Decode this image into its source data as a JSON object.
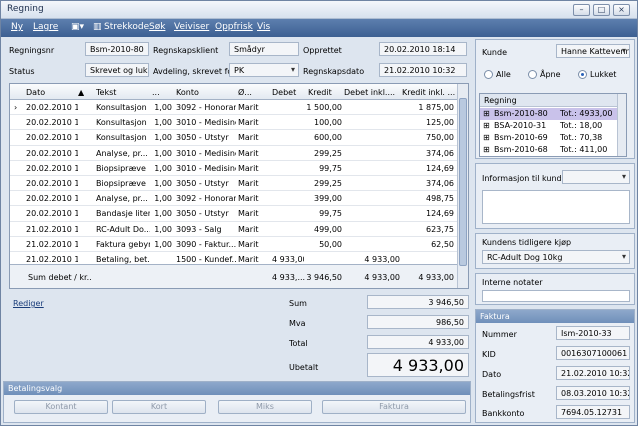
{
  "window": {
    "title": "Regning"
  },
  "menu": {
    "ny": "Ny",
    "lagre": "Lagre",
    "strekkode": "Strekkode",
    "sok": "Søk",
    "veiviser": "Veiviser",
    "oppfrisk": "Oppfrisk",
    "vis": "Vis"
  },
  "header": {
    "regningsnr_label": "Regningsnr",
    "regningsnr": "Bsm-2010-80",
    "klient_label": "Regnskapsklient",
    "klient": "Smådyr",
    "opprettet_label": "Opprettet",
    "opprettet": "20.02.2010 18:14",
    "status_label": "Status",
    "status": "Skrevet og lukket",
    "avdeling_label": "Avdeling, skrevet for",
    "avdeling": "PK",
    "regnskapsdato_label": "Regnskapsdato",
    "regnskapsdato": "21.02.2010 10:32"
  },
  "grid": {
    "headers": [
      "Dato",
      "Tekst",
      "...",
      "Konto",
      "Ø...",
      "Debet",
      "Kredit",
      "Debet inkl....",
      "Kredit inkl. ..."
    ],
    "rows": [
      [
        "20.02.2010 18:14",
        "Konsultasjon",
        "1,00",
        "3092 - Honorar",
        "Marit",
        "",
        "1 500,00",
        "",
        "1 875,00"
      ],
      [
        "20.02.2010 18:14",
        "Konsultasjon",
        "1,00",
        "3010 - Medisiner",
        "Marit",
        "",
        "100,00",
        "",
        "125,00"
      ],
      [
        "20.02.2010 18:14",
        "Konsultasjon",
        "1,00",
        "3050 - Utstyr",
        "Marit",
        "",
        "600,00",
        "",
        "750,00"
      ],
      [
        "20.02.2010 18:28",
        "Analyse, pr...",
        "1,00",
        "3010 - Medisiner",
        "Marit",
        "",
        "299,25",
        "",
        "374,06"
      ],
      [
        "20.02.2010 18:28",
        "Biopsipræve",
        "1,00",
        "3010 - Medisiner",
        "Marit",
        "",
        "99,75",
        "",
        "124,69"
      ],
      [
        "20.02.2010 18:28",
        "Biopsipræve",
        "1,00",
        "3050 - Utstyr",
        "Marit",
        "",
        "299,25",
        "",
        "374,06"
      ],
      [
        "20.02.2010 18:28",
        "Analyse, pr...",
        "1,00",
        "3092 - Honorar",
        "Marit",
        "",
        "399,00",
        "",
        "498,75"
      ],
      [
        "20.02.2010 18:29",
        "Bandasje liten",
        "1,00",
        "3050 - Utstyr",
        "Marit",
        "",
        "99,75",
        "",
        "124,69"
      ],
      [
        "21.02.2010 10:21",
        "RC-Adult Do...",
        "1,00",
        "3093 - Salg",
        "Marit",
        "",
        "499,00",
        "",
        "623,75"
      ],
      [
        "21.02.2010 10:32",
        "Faktura gebyr",
        "1,00",
        "3090 - Faktur...",
        "Marit",
        "",
        "50,00",
        "",
        "62,50"
      ],
      [
        "21.02.2010 10:32",
        "Betaling, bet...",
        "",
        "1500 - Kundef...",
        "Marit",
        "4 933,00",
        "",
        "4 933,00",
        ""
      ]
    ],
    "footer": {
      "label": "Sum debet / kr...",
      "debet": "4 933,...",
      "kredit": "3 946,50",
      "debet_inkl": "4 933,00",
      "kredit_inkl": "4 933,00"
    }
  },
  "rediger": "Rediger",
  "totals": {
    "sum_label": "Sum",
    "sum": "3 946,50",
    "mva_label": "Mva",
    "mva": "986,50",
    "total_label": "Total",
    "total": "4 933,00",
    "ubetalt_label": "Ubetalt",
    "ubetalt": "4 933,00"
  },
  "betalingsvalg": {
    "title": "Betalingsvalg",
    "kontant": "Kontant",
    "kort": "Kort",
    "miks": "Miks",
    "faktura": "Faktura"
  },
  "right": {
    "kunde_label": "Kunde",
    "kunde": "Hanne Kattevenn",
    "alle": "Alle",
    "apne": "Åpne",
    "lukket": "Lukket",
    "regning_header": "Regning",
    "tree": [
      [
        "Bsm-2010-80",
        "Tot.: 4933,00"
      ],
      [
        "BSA-2010-31",
        "Tot.: 18,00"
      ],
      [
        "Bsm-2010-69",
        "Tot.: 70,38"
      ],
      [
        "Bsm-2010-68",
        "Tot.: 411,00"
      ]
    ],
    "info_label": "Informasjon til kunden",
    "tidligere_label": "Kundens tidligere kjøp",
    "tidligere": "RC-Adult Dog 10kg",
    "notater_label": "Interne notater"
  },
  "faktura": {
    "title": "Faktura",
    "nummer_label": "Nummer",
    "nummer": "Ism-2010-33",
    "kid_label": "KID",
    "kid": "0016307100061",
    "dato_label": "Dato",
    "dato": "21.02.2010 10:32",
    "frist_label": "Betalingsfrist",
    "frist": "08.03.2010 10:32",
    "bank_label": "Bankkonto",
    "bank": "7694.05.12731"
  }
}
